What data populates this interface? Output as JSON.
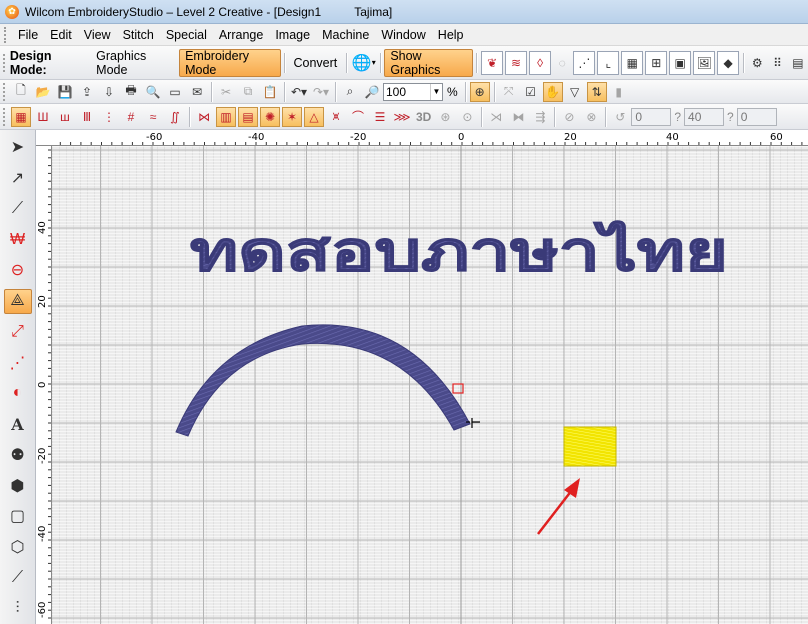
{
  "window": {
    "title": "Wilcom EmbroideryStudio – Level 2 Creative - [Design1          Tajima]"
  },
  "menu": [
    "File",
    "Edit",
    "View",
    "Stitch",
    "Special",
    "Arrange",
    "Image",
    "Machine",
    "Window",
    "Help"
  ],
  "toolbar1": {
    "design_mode_label": "Design Mode:",
    "graphics_mode": "Graphics Mode",
    "embroidery_mode": "Embroidery Mode",
    "convert": "Convert",
    "show_graphics": "Show Graphics"
  },
  "toolbar2": {
    "zoom_value": "100",
    "zoom_unit": "%"
  },
  "toolbar3": {
    "label_3d": "3D",
    "field_1": "0",
    "field_2": "40",
    "field_3": "0",
    "q_mark": "?"
  },
  "ruler": {
    "top_labels": [
      "-60",
      "-40",
      "-20",
      "0",
      "20",
      "40",
      "60"
    ],
    "left_labels": [
      "40",
      "20",
      "0",
      "-20",
      "-40",
      "-60"
    ]
  },
  "design": {
    "thai_text": "ทดสอบภาษาไทย",
    "thread_color": "#4a4a8a",
    "swatch_color": "#f5ea00",
    "arrow_color": "#e02020"
  }
}
